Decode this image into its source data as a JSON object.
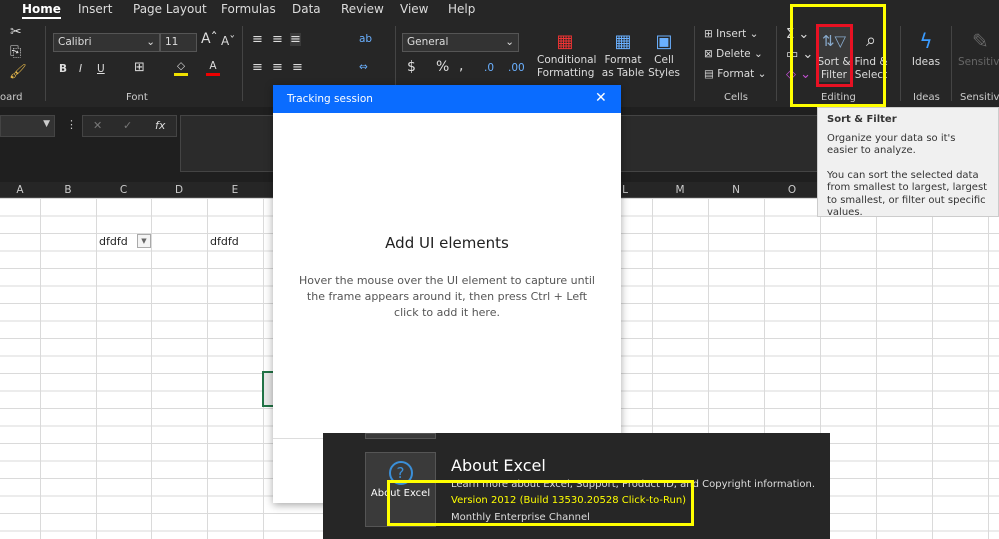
{
  "ribbon": {
    "tabs": [
      "Home",
      "Insert",
      "Page Layout",
      "Formulas",
      "Data",
      "Review",
      "View",
      "Help"
    ],
    "active_tab": "Home",
    "font_name": "Calibri",
    "font_size": "11",
    "number_format": "General",
    "groups": {
      "clipboard": "oard",
      "font": "Font",
      "cells": "Cells",
      "editing": "Editing",
      "ideas": "Ideas",
      "sensitivity": "Sensitivi"
    },
    "buttons": {
      "conditional_formatting": "Conditional Formatting",
      "format_as_table": "Format as Table",
      "cell_styles": "Cell Styles",
      "insert": "Insert",
      "delete": "Delete",
      "format": "Format",
      "sort_filter": "Sort & Filter",
      "find_select": "Find & Select",
      "ideas": "Ideas",
      "sensitivity": "Sensitivity",
      "bold": "B",
      "italic": "I",
      "underline": "U",
      "fx": "fx"
    }
  },
  "grid": {
    "columns": [
      "A",
      "B",
      "C",
      "D",
      "E",
      "L",
      "M",
      "N",
      "O"
    ],
    "cells": {
      "c3": "dfdfd",
      "e3": "dfdfd"
    }
  },
  "tooltip": {
    "title": "Sort & Filter",
    "line1": "Organize your data so it's easier to analyze.",
    "line2": "You can sort the selected data from smallest to largest, largest to smallest, or filter out specific values."
  },
  "dialog": {
    "title": "Tracking session",
    "heading": "Add UI elements",
    "body": "Hover the mouse over the UI element to capture until the frame appears around it, then press Ctrl + Left click to add it here."
  },
  "about": {
    "button": "About Excel",
    "title": "About Excel",
    "desc": "Learn more about Excel, Support, Product ID, and Copyright information.",
    "version": "Version 2012 (Build 13530.20528 Click-to-Run)",
    "channel": "Monthly Enterprise Channel"
  },
  "colors": {
    "dialog_header": "#0a6cff",
    "highlight_yellow": "#ffff00",
    "highlight_red": "#e81123",
    "version_text": "#ffff00"
  }
}
